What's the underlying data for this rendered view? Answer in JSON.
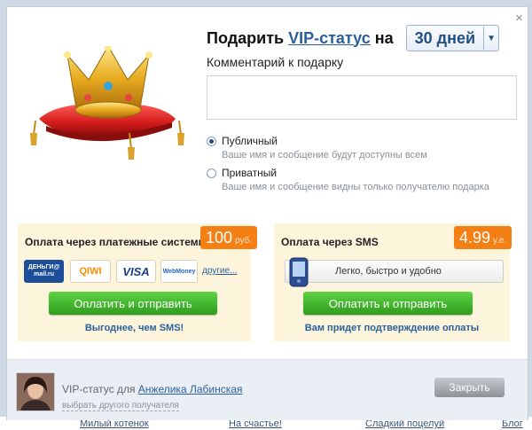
{
  "background": {
    "links": [
      "Милый котенок",
      "На счастье!",
      "Сладкий поцелуй",
      "Блог"
    ]
  },
  "dialog": {
    "close_symbol": "×",
    "title": {
      "prefix": "Подарить",
      "vip_link": "VIP-статус",
      "suffix": "на",
      "duration_value": "30 дней"
    },
    "comment_label": "Комментарий к подарку",
    "comment_value": "",
    "visibility": {
      "public_label": "Публичный",
      "public_desc": "Ваше имя и сообщение будут доступны всем",
      "private_label": "Приватный",
      "private_desc": "Ваше имя и сообщение видны только получателю подарка",
      "selected": "public"
    },
    "payment_systems": {
      "title": "Оплата через платежные системы",
      "price": "100",
      "currency": "руб.",
      "logos": [
        "ДЕНЬГИ@mail.ru",
        "QIWI",
        "VISA",
        "WebMoney"
      ],
      "others_link": "другие...",
      "button_label": "Оплатить и отправить",
      "note": "Выгоднее, чем SMS!"
    },
    "sms_payment": {
      "title": "Оплата через SMS",
      "price": "4.99",
      "currency": "у.е.",
      "tagline": "Легко, быстро и удобно",
      "button_label": "Оплатить и отправить",
      "note": "Вам придет подтверждение оплаты"
    },
    "footer": {
      "vip_for_text": "VIP-статус для",
      "recipient_name": "Анжелика Лабинская",
      "choose_other": "выбрать другого получателя",
      "close_button": "Закрыть"
    }
  },
  "colors": {
    "accent_blue": "#2a5f9e",
    "price_orange": "#f47f15",
    "pay_green": "#3db52a",
    "panel_cream": "#fcf5dc"
  },
  "icons": [
    "crown-pillow-icon",
    "phone-icon",
    "close-icon",
    "chevron-down-icon"
  ]
}
